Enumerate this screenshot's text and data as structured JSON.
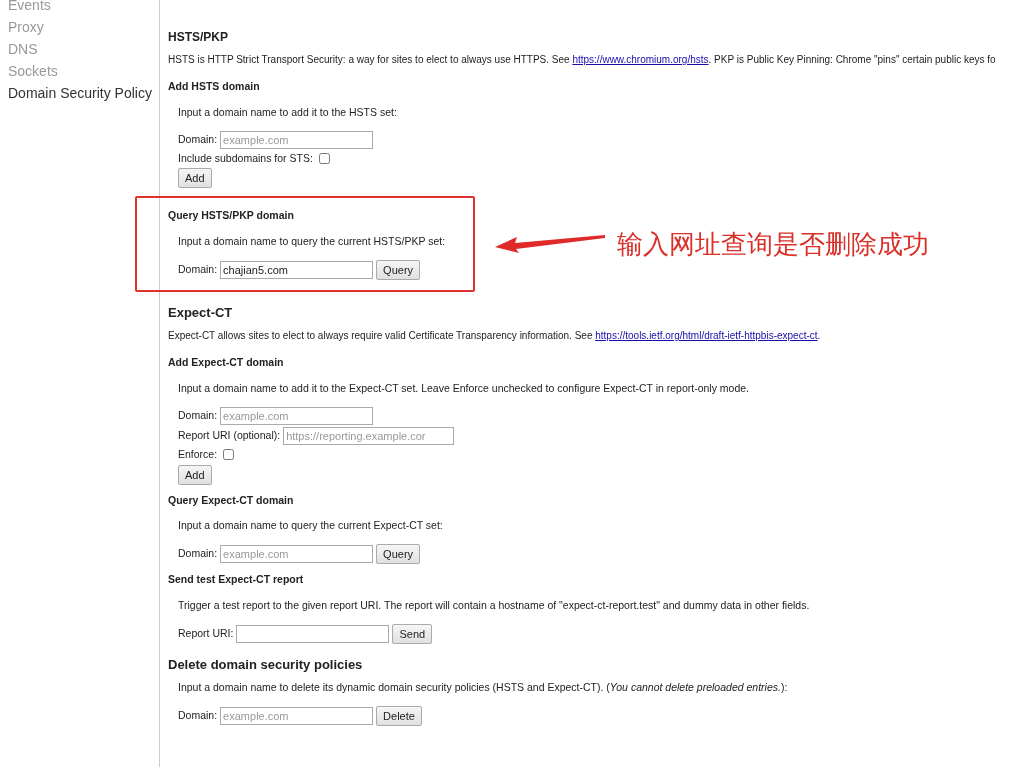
{
  "sidebar": {
    "items": [
      {
        "label": "Events",
        "selected": false
      },
      {
        "label": "Proxy",
        "selected": false
      },
      {
        "label": "DNS",
        "selected": false
      },
      {
        "label": "Sockets",
        "selected": false
      },
      {
        "label": "Domain Security Policy",
        "selected": true
      }
    ]
  },
  "content": [
    {
      "kind": "heading",
      "text": "HSTS/PKP"
    },
    {
      "kind": "paragraph",
      "parts": [
        {
          "kind": "text",
          "text": "HSTS is HTTP Strict Transport Security: a way for sites to elect to always use HTTPS. See "
        },
        {
          "kind": "link",
          "text": "https://www.chromium.org/hsts"
        },
        {
          "kind": "text",
          "text": ". PKP is Public Key Pinning: Chrome \"pins\" certain public keys fo"
        }
      ]
    },
    {
      "kind": "subsection",
      "title": "Add HSTS domain",
      "intro": "Input a domain name to add it to the HSTS set:",
      "highlighted": false,
      "rows": [
        {
          "kind": "input",
          "label": "Domain:",
          "placeholder": "example.com"
        },
        {
          "kind": "checkbox",
          "label": "Include subdomains for STS:",
          "checked": false
        },
        {
          "kind": "button",
          "label": "Add"
        }
      ]
    },
    {
      "kind": "subsection",
      "title": "Query HSTS/PKP domain",
      "intro": "Input a domain name to query the current HSTS/PKP set:",
      "highlighted": true,
      "annotation": "输入网址查询是否删除成功",
      "rows": [
        {
          "kind": "input",
          "label": "Domain:",
          "value": "chajian5.com",
          "button": "Query"
        }
      ]
    },
    {
      "kind": "heading",
      "text": "Expect-CT"
    },
    {
      "kind": "paragraph",
      "parts": [
        {
          "kind": "text",
          "text": "Expect-CT allows sites to elect to always require valid Certificate Transparency information. See "
        },
        {
          "kind": "link",
          "text": "https://tools.ietf.org/html/draft-ietf-httpbis-expect-ct"
        },
        {
          "kind": "text",
          "text": "."
        }
      ]
    },
    {
      "kind": "subsection",
      "title": "Add Expect-CT domain",
      "intro": "Input a domain name to add it to the Expect-CT set. Leave Enforce unchecked to configure Expect-CT in report-only mode.",
      "highlighted": false,
      "rows": [
        {
          "kind": "input",
          "label": "Domain:",
          "placeholder": "example.com"
        },
        {
          "kind": "input",
          "label": "Report URI (optional):",
          "placeholder": "https://reporting.example.cor"
        },
        {
          "kind": "checkbox",
          "label": "Enforce:",
          "checked": false
        },
        {
          "kind": "button",
          "label": "Add"
        }
      ]
    },
    {
      "kind": "subsection",
      "title": "Query Expect-CT domain",
      "intro": "Input a domain name to query the current Expect-CT set:",
      "highlighted": false,
      "rows": [
        {
          "kind": "input",
          "label": "Domain:",
          "placeholder": "example.com",
          "button": "Query"
        }
      ]
    },
    {
      "kind": "subsection",
      "title": "Send test Expect-CT report",
      "intro": "Trigger a test report to the given report URI. The report will contain a hostname of \"expect-ct-report.test\" and dummy data in other fields.",
      "highlighted": false,
      "rows": [
        {
          "kind": "input",
          "label": "Report URI:",
          "button": "Send"
        }
      ]
    },
    {
      "kind": "heading",
      "text": "Delete domain security policies"
    },
    {
      "kind": "subsection",
      "intro": "Input a domain name to delete its dynamic domain security policies (HSTS and Expect-CT). (*You cannot delete preloaded entries.*):",
      "highlighted": false,
      "rows": [
        {
          "kind": "input",
          "label": "Domain:",
          "placeholder": "example.com",
          "button": "Delete"
        }
      ]
    }
  ]
}
